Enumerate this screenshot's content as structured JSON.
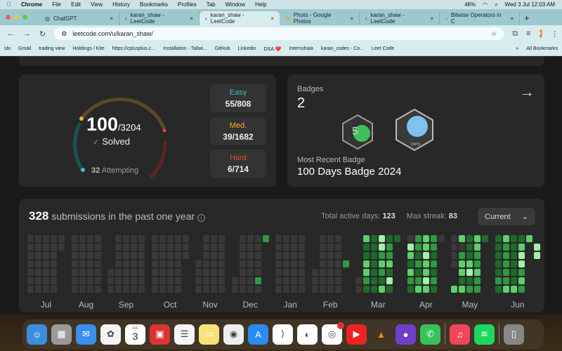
{
  "menubar": {
    "app": "Chrome",
    "items": [
      "File",
      "Edit",
      "View",
      "History",
      "Bookmarks",
      "Profiles",
      "Tab",
      "Window",
      "Help"
    ],
    "battery": "46%",
    "datetime": "Wed 3 Jul  12:03 AM"
  },
  "tabs": [
    {
      "label": "ChatGPT",
      "icon": "chatgpt-icon"
    },
    {
      "label": "karan_shaw - LeetCode",
      "icon": "leetcode-icon"
    },
    {
      "label": "karan_shaw - LeetCode",
      "icon": "leetcode-icon",
      "active": true
    },
    {
      "label": "Photo - Google Photos",
      "icon": "photos-icon"
    },
    {
      "label": "karan_shaw - LeetCode",
      "icon": "leetcode-icon"
    },
    {
      "label": "Bitwise Operators in C",
      "icon": "page-icon"
    }
  ],
  "address": {
    "url": "leetcode.com/u/karan_shaw/",
    "avatar": "K"
  },
  "bookmarks": [
    "sbi",
    "Gmail",
    "trading view",
    "Holdings / Kite",
    "https://cplusplus.c...",
    "Installation - Tailwi...",
    "GitHub",
    "Linkedin",
    "DSA ❤️",
    "Internshala",
    "karan_codes - Co...",
    "Leet Code",
    "All Bookmarks"
  ],
  "solved": {
    "count": "100",
    "total": "/3204",
    "label": "Solved",
    "attempting_count": "32",
    "attempting_label": "Attempting",
    "difficulties": [
      {
        "label": "Easy",
        "value": "55/808",
        "color": "#4cb7c0"
      },
      {
        "label": "Med.",
        "value": "39/1682",
        "color": "#f0b429"
      },
      {
        "label": "Hard",
        "value": "6/714",
        "color": "#e0463f"
      }
    ]
  },
  "badges": {
    "title": "Badges",
    "count": "2",
    "recent_label": "Most Recent Badge",
    "recent_name": "100 Days Badge 2024",
    "badge_text": "DAYS"
  },
  "heatmap": {
    "count": "328",
    "title": " submissions in the past one year",
    "active_label": "Total active days:",
    "active_value": "123",
    "streak_label": "Max streak:",
    "streak_value": "83",
    "selector": "Current",
    "level_colors": [
      "#393939",
      "#1e6b2d",
      "#2f9a42",
      "#5dcf6b",
      "#a6eeab"
    ],
    "months": [
      {
        "label": "Jul",
        "cols": [
          "0000000",
          "0000000",
          "0000000",
          "0000000",
          "00....."
        ]
      },
      {
        "label": "Aug",
        "cols": [
          "0000000",
          "0000000",
          "0000000",
          "0000000"
        ]
      },
      {
        "label": "Sep",
        "cols": [
          "....000",
          "0000000",
          "0000000",
          "0000000",
          "0000000"
        ]
      },
      {
        "label": "Oct",
        "cols": [
          "0000000",
          "0000000",
          "0000000",
          "0000000",
          "000...."
        ]
      },
      {
        "label": "Nov",
        "cols": [
          "...0000",
          "0000000",
          "0000000",
          "0000000"
        ]
      },
      {
        "label": "Dec",
        "cols": [
          ".....00",
          "0000000",
          "0000000",
          "0000020",
          "2......"
        ]
      },
      {
        "label": "Jan",
        "cols": [
          "0000000",
          "0000000",
          "0000000",
          "0000000"
        ]
      },
      {
        "label": "Feb",
        "cols": [
          "....000",
          "0000000",
          "0000000",
          "0000000",
          "...2..."
        ]
      },
      {
        "label": "Mar",
        "cols": [
          ".....00",
          "3113321",
          "1111111",
          "4423213",
          "1223141",
          "1......"
        ]
      },
      {
        "label": "Apr",
        "cols": [
          "0431321",
          "2212123",
          "3343343",
          "2212121",
          "0......"
        ]
      },
      {
        "label": "May",
        "cols": [
          "0000..3",
          "3023313",
          "1113412",
          "3322322",
          "1......"
        ]
      },
      {
        "label": "Jun",
        "cols": [
          "1111121",
          "3222223",
          "1111113",
          "1344232",
          "3......",
          " 44...."
        ]
      }
    ]
  },
  "dock": [
    "finder",
    "launchpad",
    "mail",
    "photos",
    "calendar",
    "photo-booth",
    "reminders",
    "notes",
    "chrome",
    "app-store",
    "vscode",
    "edge",
    "instagram",
    "youtube",
    "vlc",
    "github",
    "whatsapp",
    "music",
    "spotify",
    "trash"
  ],
  "dock_calendar": {
    "month": "JUL",
    "day": "3"
  },
  "dock_instagram_badge": "1"
}
